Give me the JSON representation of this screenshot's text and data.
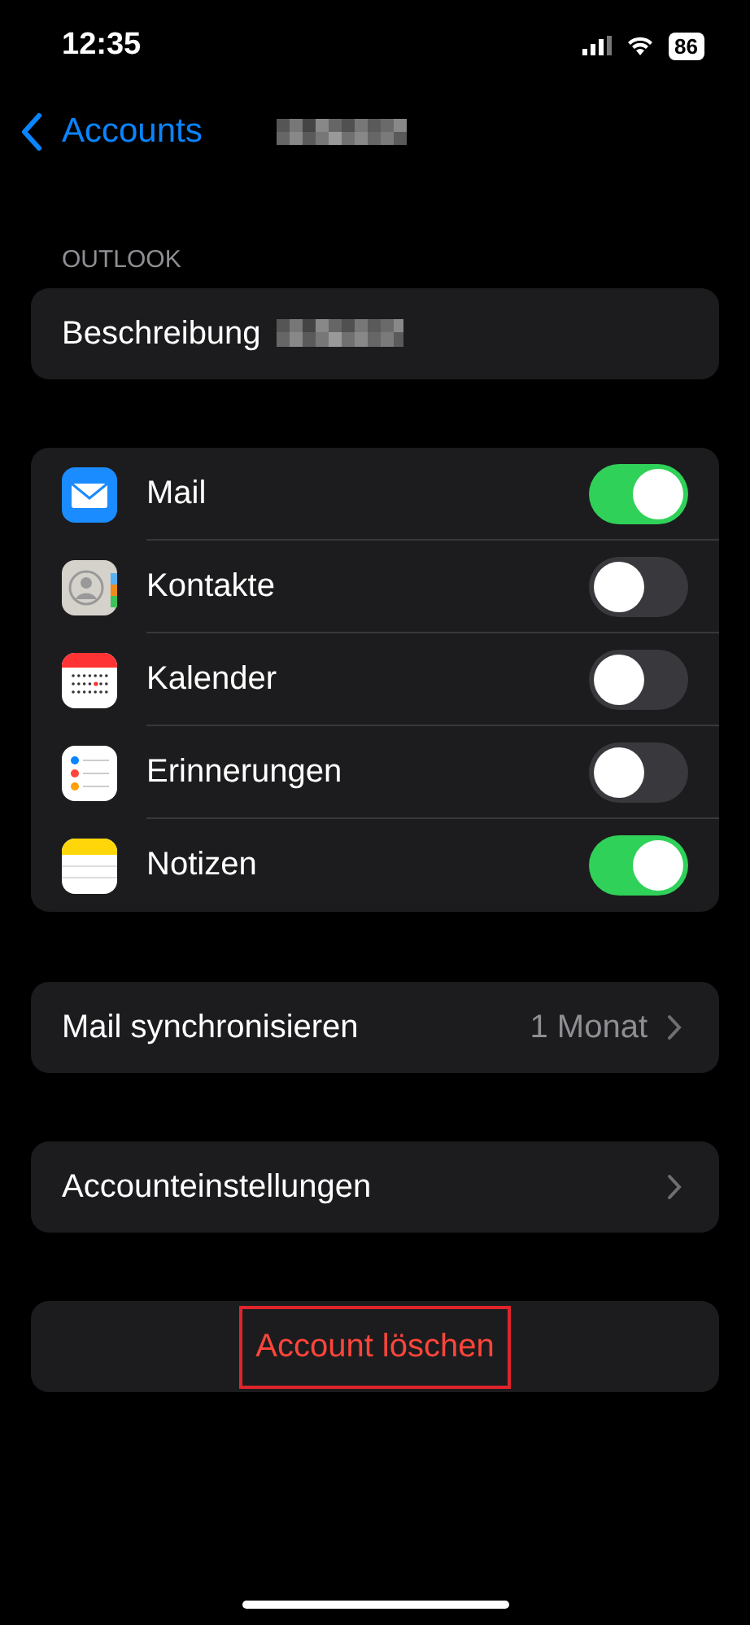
{
  "status_bar": {
    "time": "12:35",
    "battery": "86"
  },
  "nav": {
    "back": "Accounts"
  },
  "section_header": "OUTLOOK",
  "description": {
    "label": "Beschreibung"
  },
  "services": [
    {
      "kind": "mail",
      "label": "Mail",
      "on": true
    },
    {
      "kind": "contacts",
      "label": "Kontakte",
      "on": false
    },
    {
      "kind": "calendar",
      "label": "Kalender",
      "on": false
    },
    {
      "kind": "reminders",
      "label": "Erinnerungen",
      "on": false
    },
    {
      "kind": "notes",
      "label": "Notizen",
      "on": true
    }
  ],
  "sync": {
    "label": "Mail synchronisieren",
    "value": "1 Monat"
  },
  "settings": {
    "label": "Accounteinstellungen"
  },
  "delete": {
    "label": "Account löschen"
  }
}
